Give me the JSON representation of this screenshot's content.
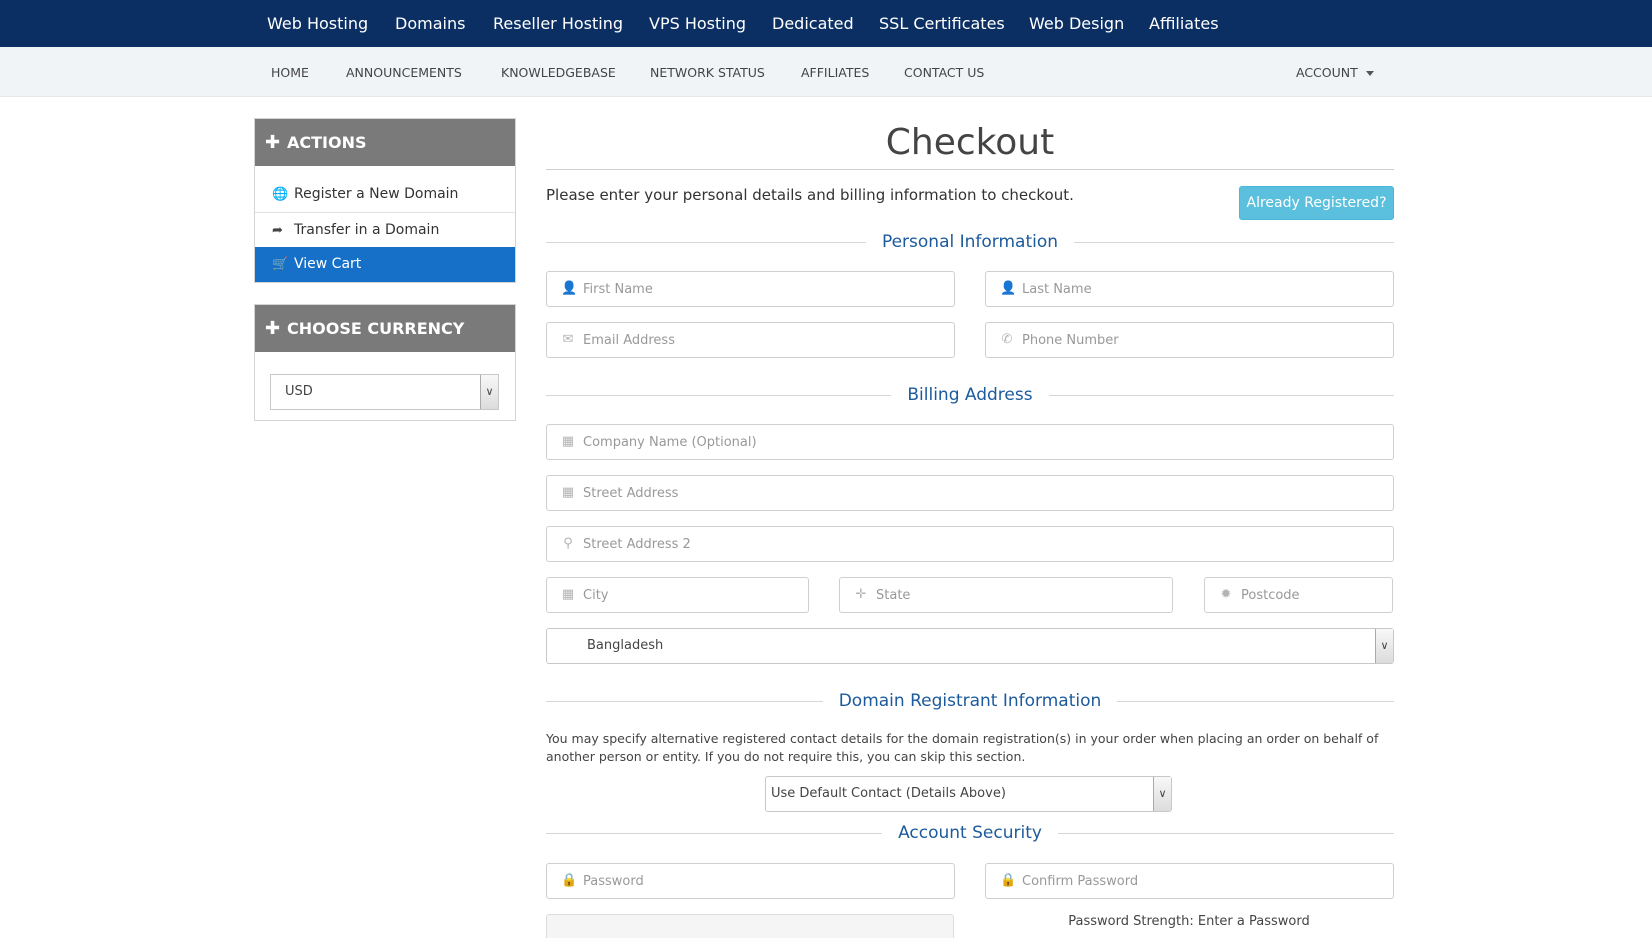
{
  "topnav": {
    "items": [
      "Web Hosting",
      "Domains",
      "Reseller Hosting",
      "VPS Hosting",
      "Dedicated",
      "SSL Certificates",
      "Web Design",
      "Affiliates"
    ]
  },
  "subnav": {
    "items": [
      "Home",
      "Announcements",
      "Knowledgebase",
      "Network Status",
      "Affiliates",
      "Contact Us"
    ],
    "account": "Account"
  },
  "sidebar": {
    "actions_title": "ACTIONS",
    "actions": [
      {
        "label": "Register a New Domain",
        "icon": "globe-icon"
      },
      {
        "label": "Transfer in a Domain",
        "icon": "share-icon"
      },
      {
        "label": "View Cart",
        "icon": "cart-icon",
        "active": true
      }
    ],
    "currency_title": "CHOOSE CURRENCY",
    "currency_value": "USD"
  },
  "checkout": {
    "title": "Checkout",
    "intro": "Please enter your personal details and billing information to checkout.",
    "already_registered": "Already Registered?"
  },
  "personal": {
    "title": "Personal Information",
    "first_name": "First Name",
    "last_name": "Last Name",
    "email": "Email Address",
    "phone": "Phone Number"
  },
  "billing": {
    "title": "Billing Address",
    "company": "Company Name (Optional)",
    "street": "Street Address",
    "street2": "Street Address 2",
    "city": "City",
    "state": "State",
    "postcode": "Postcode",
    "country": "Bangladesh"
  },
  "registrant": {
    "title": "Domain Registrant Information",
    "description": "You may specify alternative registered contact details for the domain registration(s) in your order when placing an order on behalf of another person or entity. If you do not require this, you can skip this section.",
    "contact_select": "Use Default Contact (Details Above)"
  },
  "security": {
    "title": "Account Security",
    "password": "Password",
    "confirm_password": "Confirm Password",
    "strength": "Password Strength: Enter a Password"
  }
}
